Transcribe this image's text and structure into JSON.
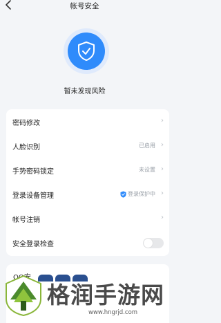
{
  "header": {
    "title": "帐号安全",
    "back_icon": "chevron-left-icon"
  },
  "status": {
    "text": "暂未发现风险",
    "icon": "shield-check-icon",
    "accent": "#2f8bfb"
  },
  "settings": [
    {
      "label": "密码修改",
      "value": ""
    },
    {
      "label": "人脸识别",
      "value": "已启用"
    },
    {
      "label": "手势密码锁定",
      "value": "未设置"
    },
    {
      "label": "登录设备管理",
      "value": "登录保护中"
    },
    {
      "label": "帐号注销",
      "value": ""
    },
    {
      "label": "安全登录检查",
      "value": "",
      "toggle": false
    }
  ],
  "qq_card": {
    "label": "QQ安"
  },
  "watermark": {
    "text": "格润手游网",
    "url": "www.hngrjd.com"
  }
}
